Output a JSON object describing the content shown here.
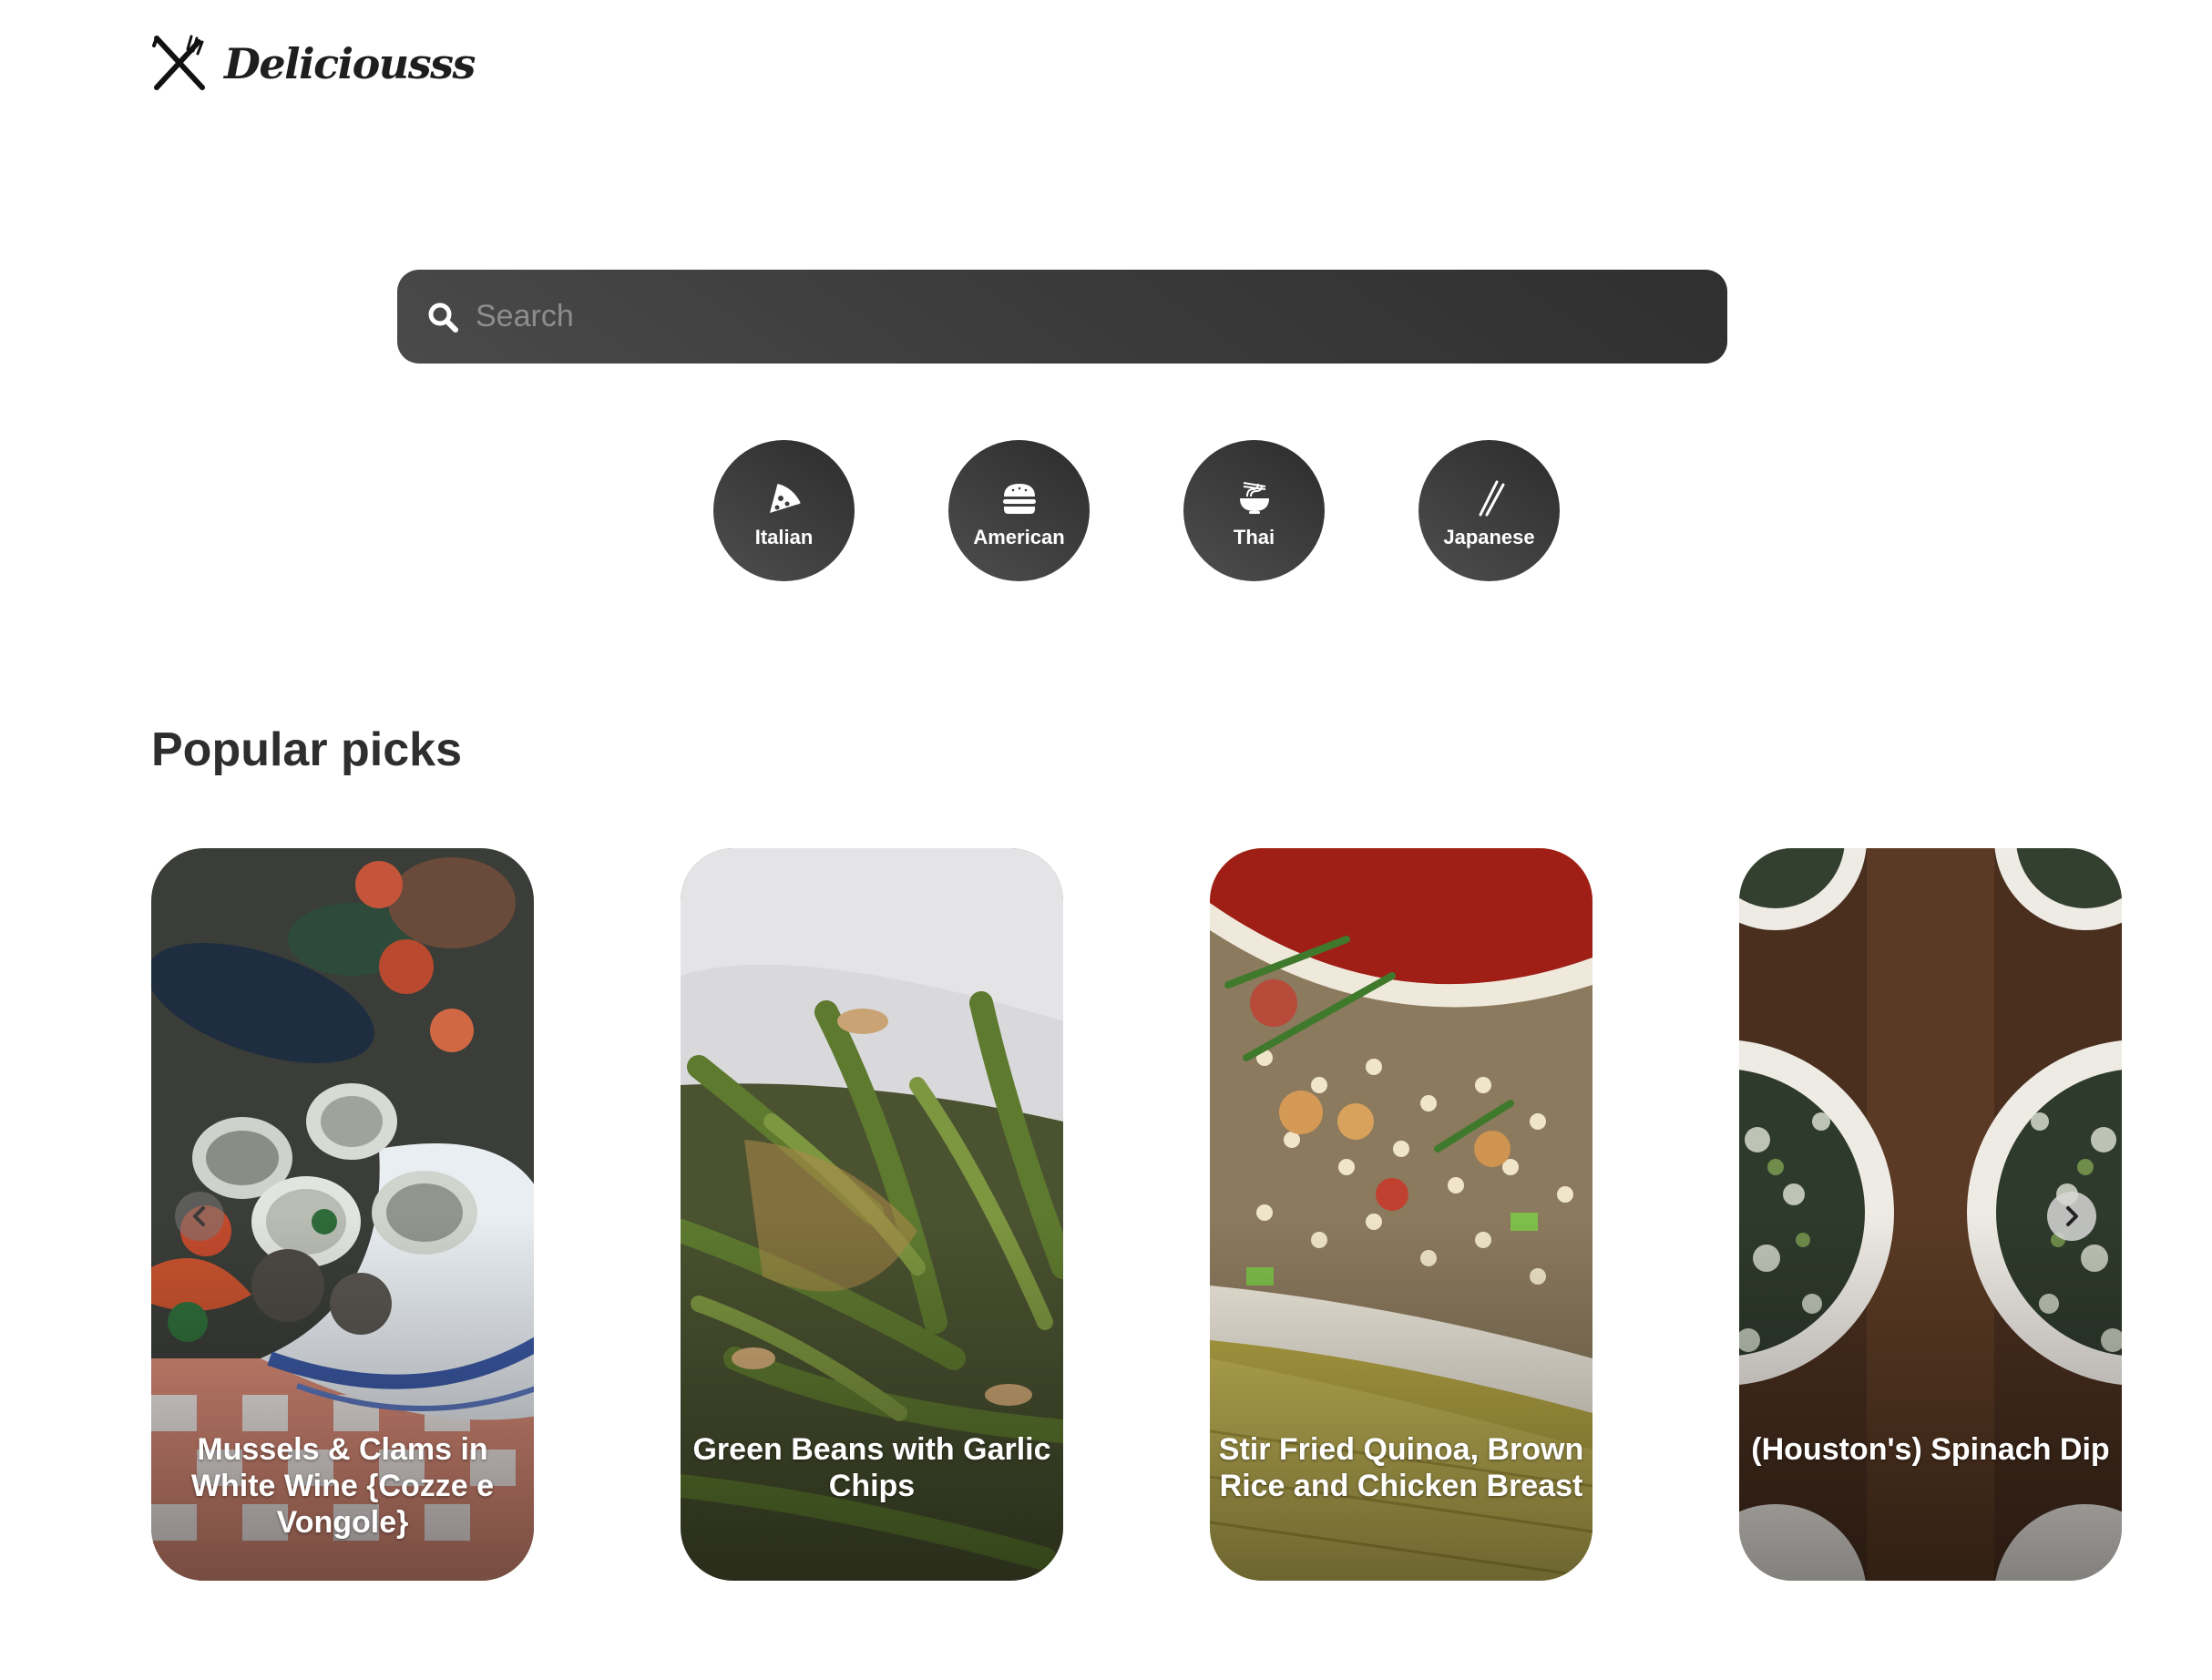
{
  "brand": {
    "name": "Deliciousss",
    "icon": "fork-knife-icon"
  },
  "search": {
    "placeholder": "Search",
    "value": "",
    "icon": "search-icon"
  },
  "cuisines": [
    {
      "label": "Italian",
      "icon": "pizza-icon"
    },
    {
      "label": "American",
      "icon": "burger-icon"
    },
    {
      "label": "Thai",
      "icon": "noodle-bowl-icon"
    },
    {
      "label": "Japanese",
      "icon": "chopsticks-icon"
    }
  ],
  "popular": {
    "title": "Popular picks",
    "items": [
      {
        "title": "Mussels & Clams in White Wine {Cozze e Vongole}"
      },
      {
        "title": "Green Beans with Garlic Chips"
      },
      {
        "title": "Stir Fried Quinoa, Brown Rice and Chicken Breast"
      },
      {
        "title": "(Houston's) Spinach Dip"
      }
    ],
    "prev_icon": "chevron-left-icon",
    "next_icon": "chevron-right-icon"
  },
  "colors": {
    "accent_dark": "#313131",
    "text": "#2e2e2e",
    "background": "#ffffff"
  }
}
